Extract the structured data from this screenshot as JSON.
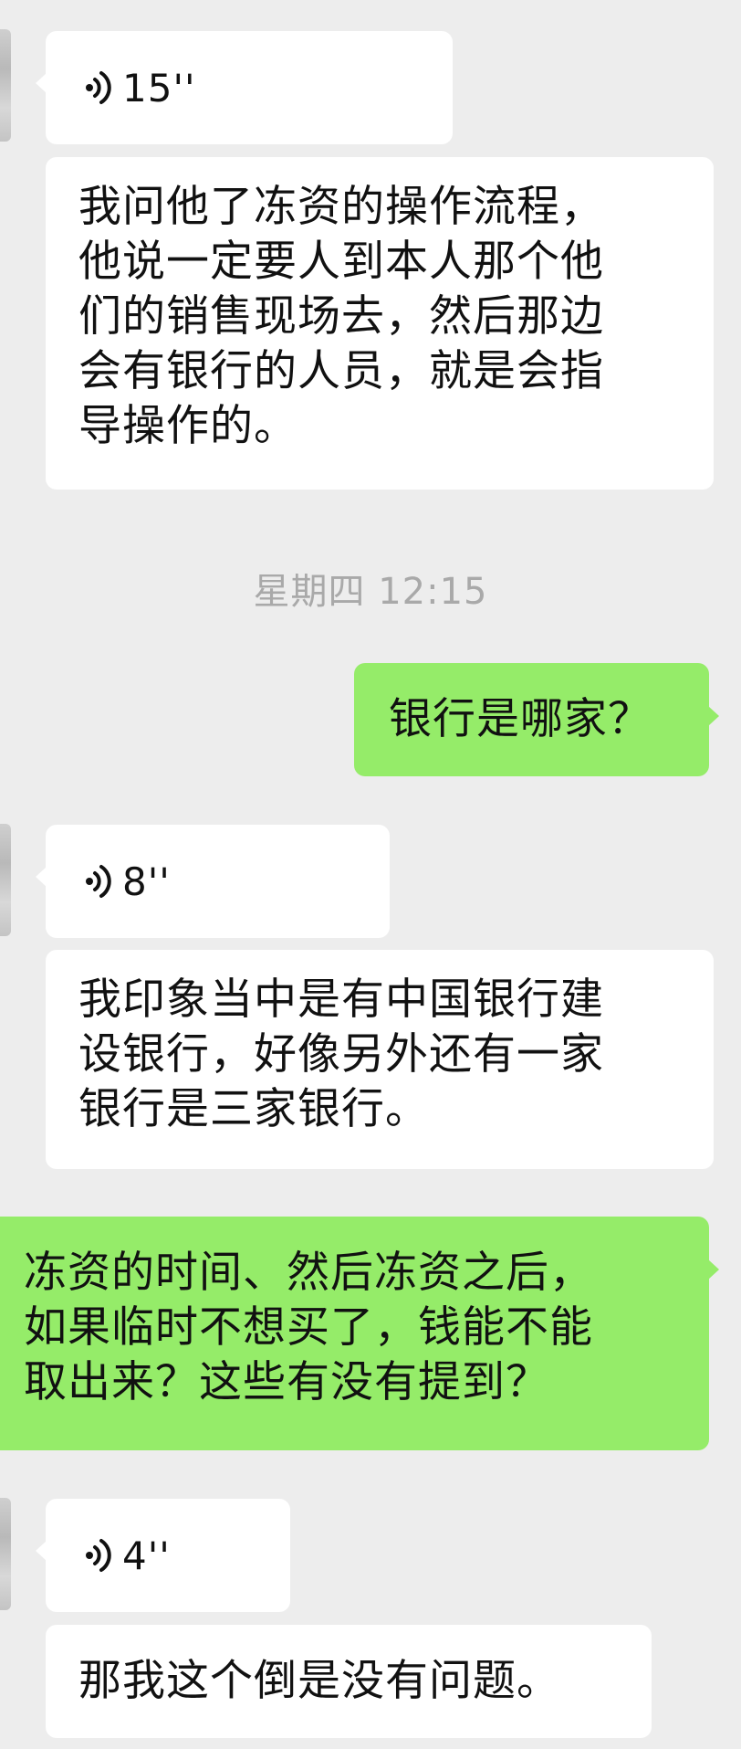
{
  "conversation": {
    "messages": [
      {
        "type": "voice",
        "side": "in",
        "duration": "15''"
      },
      {
        "type": "text",
        "side": "in",
        "text": "我问他了冻资的操作流程，\n他说一定要人到本人那个他\n们的销售现场去，然后那边\n会有银行的人员，就是会指\n导操作的。"
      },
      {
        "type": "timestamp",
        "text": "星期四 12:15"
      },
      {
        "type": "text",
        "side": "out",
        "text": "银行是哪家？"
      },
      {
        "type": "voice",
        "side": "in",
        "duration": "8''"
      },
      {
        "type": "text",
        "side": "in",
        "text": "我印象当中是有中国银行建\n设银行，好像另外还有一家\n银行是三家银行。"
      },
      {
        "type": "text",
        "side": "out",
        "text": "冻资的时间、然后冻资之后，\n如果临时不想买了，钱能不能\n取出来？这些有没有提到？"
      },
      {
        "type": "voice",
        "side": "in",
        "duration": "4''"
      },
      {
        "type": "text",
        "side": "in",
        "text": "那我这个倒是没有问题。"
      }
    ]
  },
  "colors": {
    "background": "#ededed",
    "incoming_bubble": "#ffffff",
    "outgoing_bubble": "#95ec69",
    "timestamp_text": "#a9a9a9"
  },
  "icons": {
    "voice": "voice-wave-icon",
    "avatar": "contact-avatar"
  }
}
